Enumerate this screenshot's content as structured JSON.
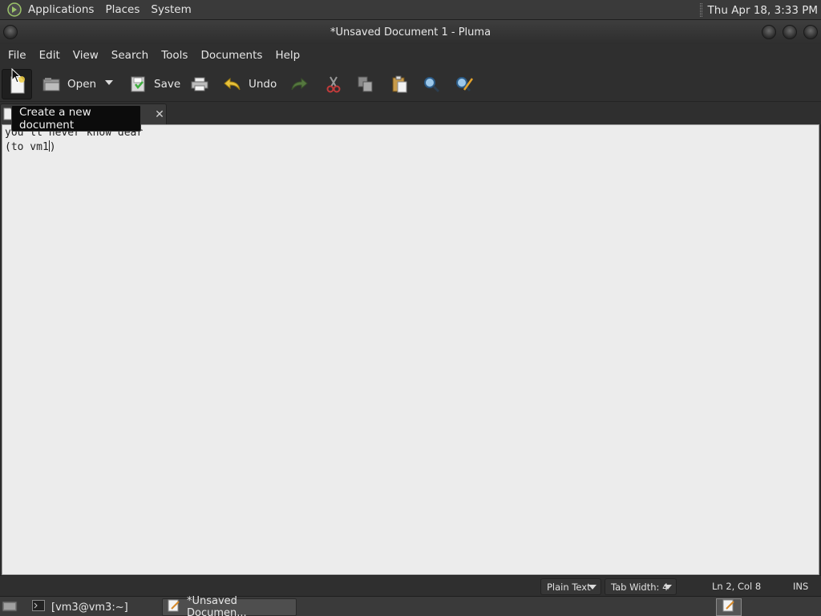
{
  "top_panel": {
    "menus": [
      "Applications",
      "Places",
      "System"
    ],
    "clock": "Thu Apr 18,  3:33 PM"
  },
  "window": {
    "title": "*Unsaved Document 1 - Pluma"
  },
  "menubar": [
    "File",
    "Edit",
    "View",
    "Search",
    "Tools",
    "Documents",
    "Help"
  ],
  "toolbar": {
    "new_icon": "new-document-icon",
    "open_label": "Open",
    "save_label": "Save",
    "undo_label": "Undo"
  },
  "tooltip": "Create a new document",
  "editor": {
    "lines": [
      "you'll never know dear",
      "(to vm1"
    ],
    "line2_tail": ")"
  },
  "statusbar": {
    "language": "Plain Text",
    "tab_width": "Tab Width:  4",
    "position": "Ln 2, Col 8",
    "mode": "INS"
  },
  "taskbar": {
    "terminal_task": "[vm3@vm3:~]",
    "editor_task": "*Unsaved Documen..."
  },
  "colors": {
    "panel_bg": "#3a3a3a",
    "editor_bg": "#ececec",
    "tooltip_bg": "#0c0c0c"
  }
}
